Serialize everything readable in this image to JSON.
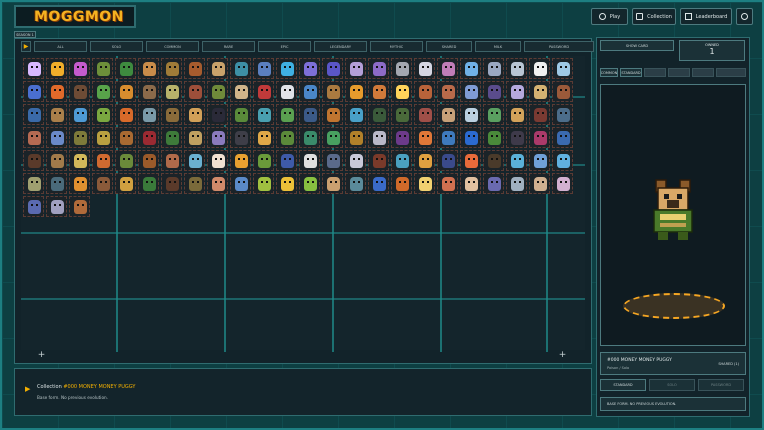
{
  "app": {
    "logo": "MOGGMON"
  },
  "top_nav": [
    {
      "label": "Play",
      "icon": "play-icon"
    },
    {
      "label": "Collection",
      "icon": "collection-icon"
    },
    {
      "label": "Leaderboard",
      "icon": "trophy-icon"
    },
    {
      "label": "",
      "icon": "settings-icon"
    }
  ],
  "season_tab": "SEASON 1",
  "filters": [
    "ALL",
    "SOLO",
    "COMMON",
    "RARE",
    "EPIC",
    "LEGENDARY",
    "MYTHIC",
    "SHARED",
    "MILK",
    "PASSWORD"
  ],
  "grid": {
    "colors": [
      "#d8b8ff",
      "#f0ad2a",
      "#c55bcd",
      "#6d8f3a",
      "#3e8a3f",
      "#c98c4a",
      "#9f7b38",
      "#a65c2e",
      "#c8a26b",
      "#3d8fa5",
      "#5a7fbf",
      "#3fb0e3",
      "#7d6fd8",
      "#5a56c8",
      "#b49fd7",
      "#8d6bc7",
      "#a3a7b0",
      "#d5d6e2",
      "#c07db8",
      "#6fb0e6",
      "#9aa8c2",
      "#b9c5d3",
      "#f0f0f0",
      "#9ec9e5",
      "#4a6fd0",
      "#e06a2a",
      "#6d4b35",
      "#58a34a",
      "#d88c2e",
      "#8a6a4a",
      "#b8b26a",
      "#9d4f3a",
      "#6f8a3a",
      "#d0b48a",
      "#c03a3a",
      "#e0e2e8",
      "#4a86c8",
      "#aa7a40",
      "#e79b2c",
      "#d07a3a",
      "#ffd35a",
      "#b8633a",
      "#b86a4a",
      "#7f9bd4",
      "#5a4c8c",
      "#b5a9dd",
      "#d4b272",
      "#9a5a3a",
      "#3a6aa8",
      "#aa7f4a",
      "#4e9ad5",
      "#7aa840",
      "#d86a2a",
      "#7a9aa8",
      "#8a6b3a",
      "#d2a058",
      "#2a2a38",
      "#5a8a3a",
      "#49a0b0",
      "#5aa050",
      "#3b5a88",
      "#c07530",
      "#49a0c8",
      "#3a5a3a",
      "#4a6a3a",
      "#9f4f48",
      "#c6a078",
      "#bbd0e0",
      "#5aa060",
      "#d3a25a",
      "#7a3a32",
      "#4c6d8a",
      "#b56a52",
      "#6a89c8",
      "#7d7a3a",
      "#b8a040",
      "#a86a32",
      "#9a2a32",
      "#3e7a3a",
      "#c0a060",
      "#8a7abd",
      "#3e3e48",
      "#e0a848",
      "#5b8a3a",
      "#3a8a6a",
      "#48a060",
      "#b0802a",
      "#b8b8c8",
      "#6c3a8a",
      "#e07838",
      "#3e7abd",
      "#2b6ad0",
      "#4a8a3a",
      "#3e3a4a",
      "#aa3a6a",
      "#3a6ab0",
      "#5a3a2a",
      "#a07a4a",
      "#d2b85a",
      "#d06a30",
      "#6a8a3a",
      "#9a5a2a",
      "#b06a4a",
      "#6ab0d0",
      "#f0e0d0",
      "#e8a030",
      "#6a9a3a",
      "#3e5aa8",
      "#e0e0e0",
      "#5a6a8a",
      "#c8c8d8",
      "#7a3a2a",
      "#4aa0c0",
      "#e0a040",
      "#3a4a8a",
      "#e86a3a",
      "#4a3a2a",
      "#5ab0d8",
      "#6fa0d8",
      "#60b0e0",
      "#a0a070",
      "#4a6a7a",
      "#e09030",
      "#8a5a3a",
      "#d0a040",
      "#3a7a3a",
      "#5a3a2a",
      "#7a6a3a",
      "#d08a6a",
      "#5a8ac8",
      "#a0c040",
      "#ecc038",
      "#88c040",
      "#caa070",
      "#5a8a9a",
      "#3a6ac8",
      "#d06a2a",
      "#f0d070",
      "#d07050",
      "#e0c0a0",
      "#6a6ab0",
      "#a0b0c0",
      "#d0b090",
      "#d2b0d0",
      "#5a6ab0",
      "#a0a0c0",
      "#b06a3a",
      "#7a3a32",
      "#b08a5a"
    ],
    "rows": 7,
    "cols": 24,
    "total": 147
  },
  "info": {
    "prefix": "Collection",
    "title": "#000 MONEY MONEY PUGGY",
    "subtitle": "Base form. No previous evolution."
  },
  "right": {
    "id_box": "SHOW CARD",
    "owned_label": "OWNED",
    "owned_value": "1",
    "variant_tabs": [
      "COMMON",
      "STANDARD"
    ],
    "name": "#000 MONEY MONEY PUGGY",
    "name_sub": "Poison / Solo",
    "badge": "SHARED (1)",
    "buttons": [
      "STANDARD",
      "SOLO",
      "PASSWORD"
    ],
    "evolution": "BASE FORM. NO PREVIOUS EVOLUTION."
  },
  "colors": {
    "accent": "#f4b000",
    "teal": "#1f8b8a",
    "panel": "#12232a"
  }
}
